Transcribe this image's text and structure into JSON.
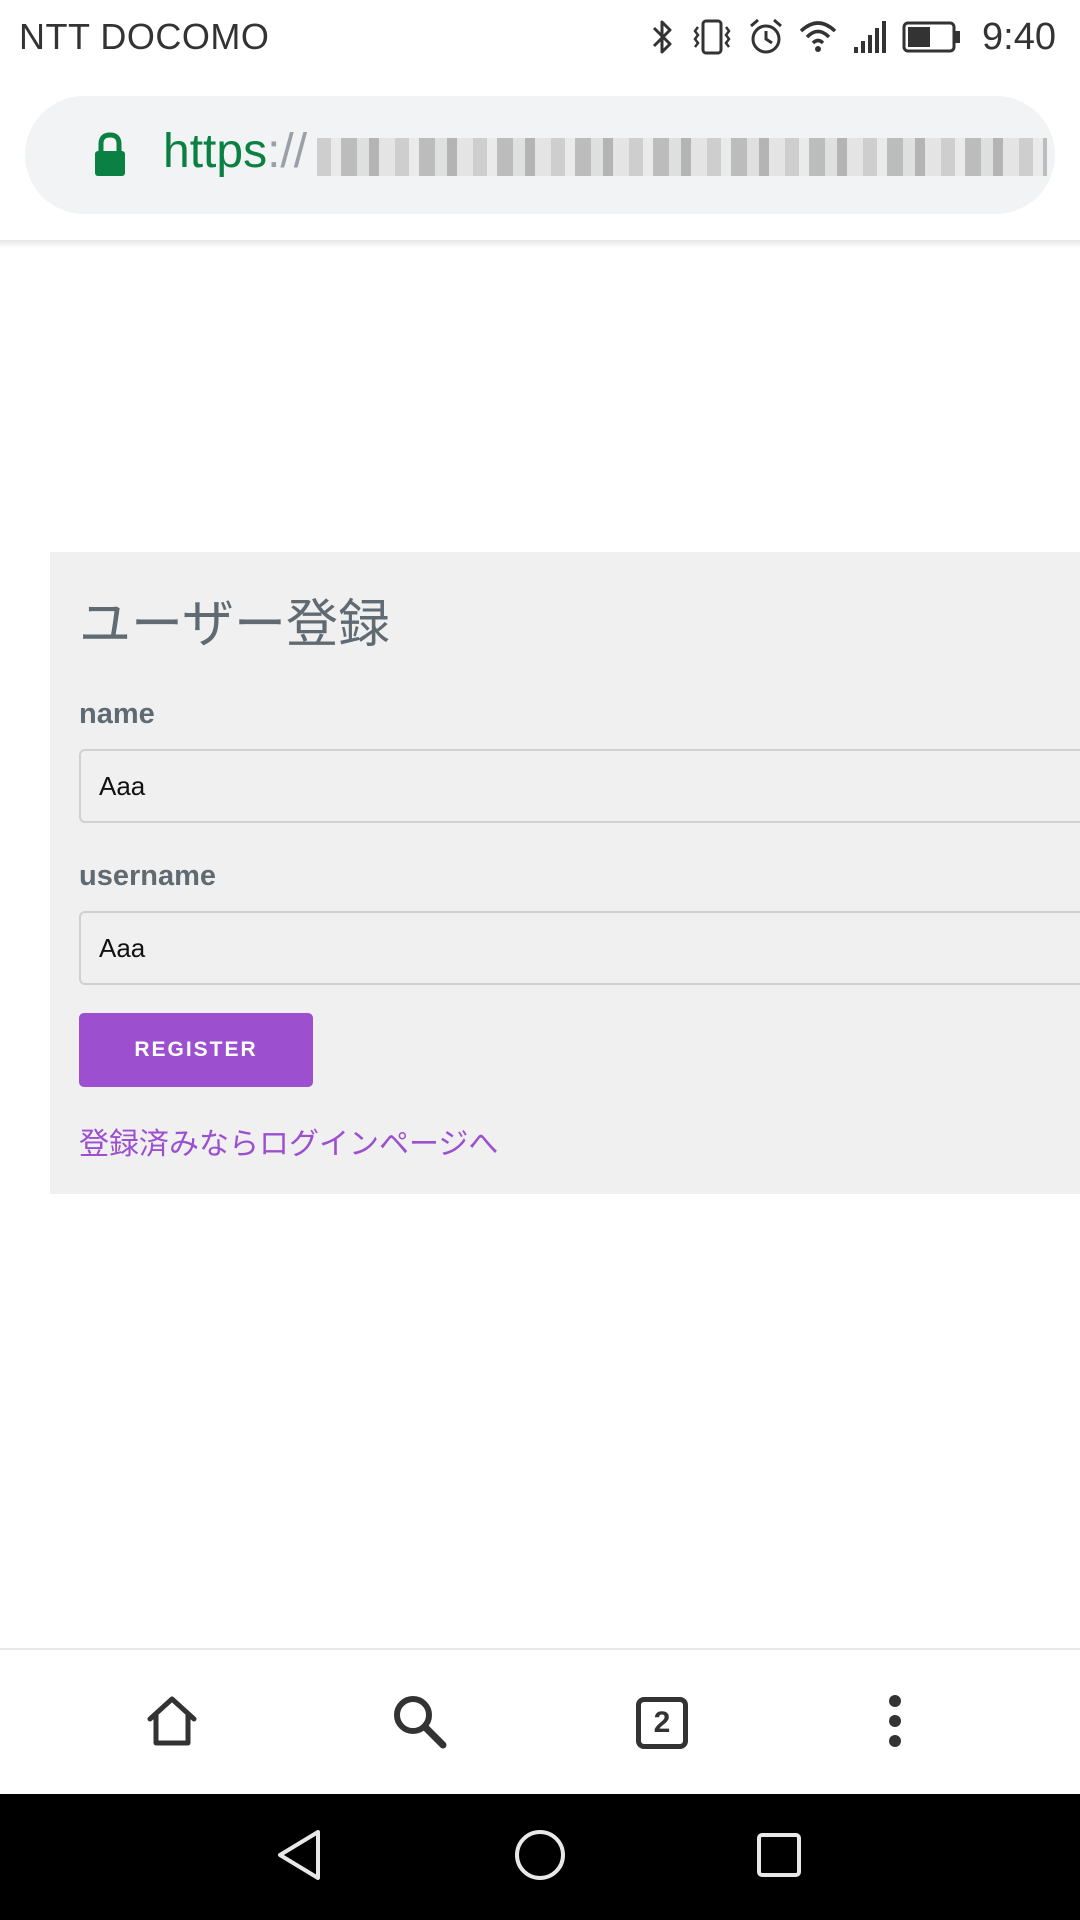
{
  "status_bar": {
    "carrier": "NTT DOCOMO",
    "time": "9:40",
    "icons": [
      "bluetooth-icon",
      "vibrate-icon",
      "alarm-icon",
      "wifi-icon",
      "signal-icon",
      "battery-icon"
    ],
    "battery_level": 0.5
  },
  "address_bar": {
    "scheme": "https",
    "separator": "://",
    "secure": true
  },
  "register_form": {
    "title": "ユーザー登録",
    "name_label": "name",
    "name_value": "Aaa",
    "username_label": "username",
    "username_value": "Aaa",
    "submit_label": "REGISTER",
    "login_link": "登録済みならログインページへ"
  },
  "browser_toolbar": {
    "tab_count": "2",
    "icons": [
      "home-icon",
      "search-icon",
      "tab-switcher-icon",
      "more-vert-icon"
    ]
  },
  "nav_bar": {
    "icons": [
      "back-icon",
      "home-icon",
      "recents-icon"
    ]
  },
  "colors": {
    "accent": "#9c4fcf",
    "secure_green": "#0b8043",
    "card_background": "#f0f0f0",
    "label_text": "#5f6a72"
  }
}
